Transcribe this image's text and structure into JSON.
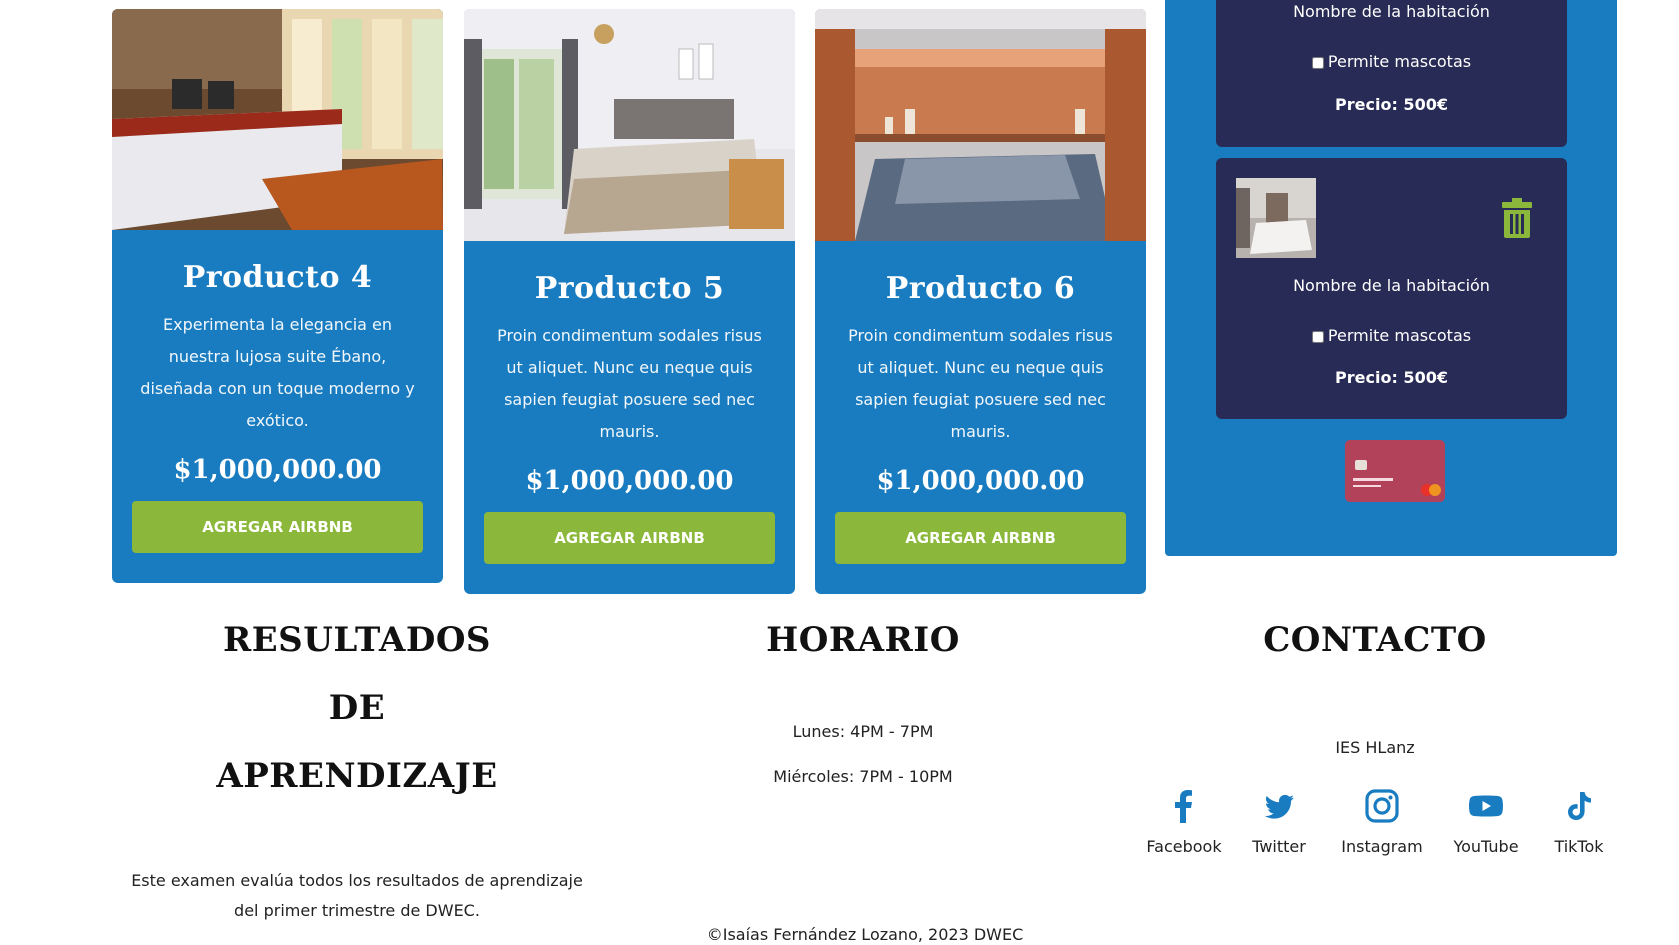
{
  "products": [
    {
      "title": "Producto 4",
      "description": "Experimenta la elegancia en nuestra lujosa suite Ébano, diseñada con un toque moderno y exótico.",
      "price": "$1,000,000.00",
      "button": "AGREGAR AIRBNB"
    },
    {
      "title": "Producto 5",
      "description": "Proin condimentum sodales risus ut aliquet. Nunc eu neque quis sapien feugiat posuere sed nec mauris.",
      "price": "$1,000,000.00",
      "button": "AGREGAR AIRBNB"
    },
    {
      "title": "Producto 6",
      "description": "Proin condimentum sodales risus ut aliquet. Nunc eu neque quis sapien feugiat posuere sed nec mauris.",
      "price": "$1,000,000.00",
      "button": "AGREGAR AIRBNB"
    }
  ],
  "cart": {
    "items": [
      {
        "name": "Nombre de la habitación",
        "pets_label": "Permite mascotas",
        "pets_checked": false,
        "price": "Precio: 500€"
      },
      {
        "name": "Nombre de la habitación",
        "pets_label": "Permite mascotas",
        "pets_checked": false,
        "price": "Precio: 500€"
      }
    ]
  },
  "footer": {
    "results": {
      "title": "RESULTADOS DE APRENDIZAJE",
      "text": "Este examen evalúa todos los resultados de aprendizaje del primer trimestre de DWEC."
    },
    "schedule": {
      "title": "HORARIO",
      "lines": [
        "Lunes: 4PM - 7PM",
        "Miércoles: 7PM - 10PM"
      ]
    },
    "contact": {
      "title": "CONTACTO",
      "org": "IES HLanz",
      "social": [
        {
          "label": "Facebook",
          "icon": "facebook-icon"
        },
        {
          "label": "Twitter",
          "icon": "twitter-icon"
        },
        {
          "label": "Instagram",
          "icon": "instagram-icon"
        },
        {
          "label": "YouTube",
          "icon": "youtube-icon"
        },
        {
          "label": "TikTok",
          "icon": "tiktok-icon"
        }
      ]
    },
    "copyright": "©Isaías Fernández Lozano, 2023 DWEC"
  },
  "colors": {
    "card_bg": "#1a7cc0",
    "button": "#8bb83a",
    "cart_item_bg": "#272b55",
    "trash": "#8bb83a",
    "icon": "#1a7cc0"
  }
}
